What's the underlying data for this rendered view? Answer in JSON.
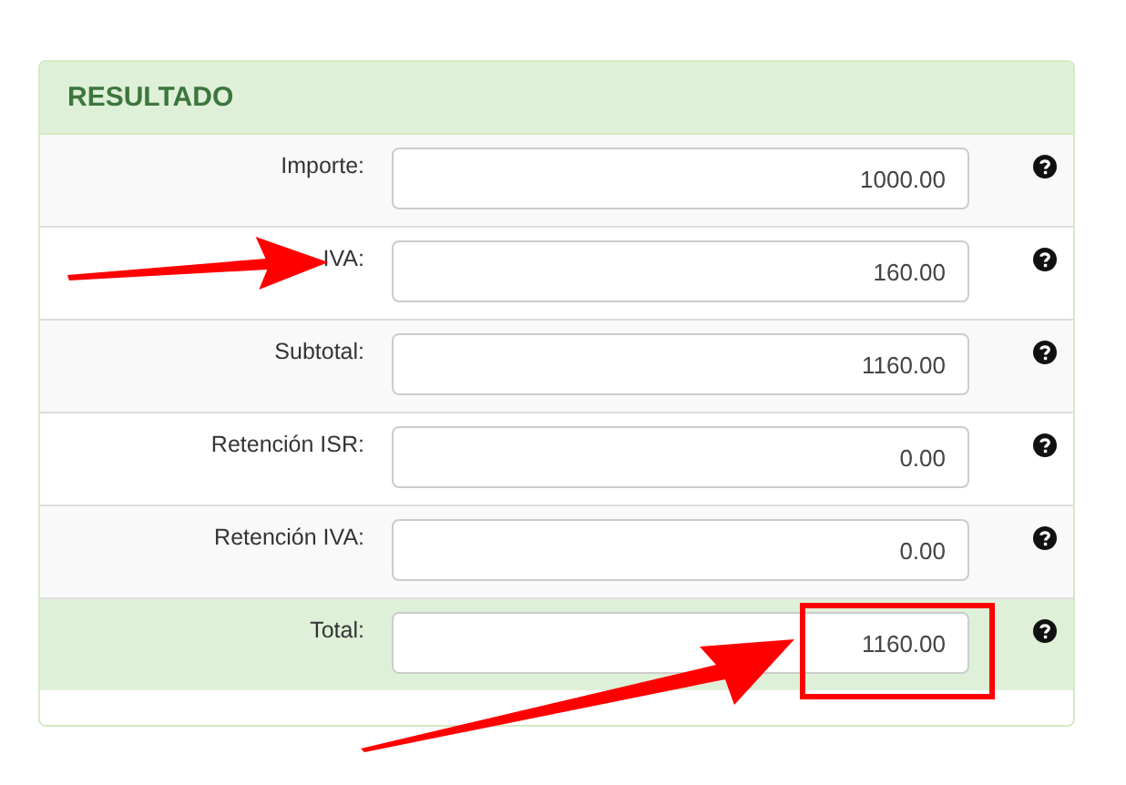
{
  "panel": {
    "title": "RESULTADO"
  },
  "rows": [
    {
      "label": "Importe:",
      "value": "1000.00",
      "highlighted": false,
      "pointed": false,
      "boxed": false
    },
    {
      "label": "IVA:",
      "value": "160.00",
      "highlighted": false,
      "pointed": true,
      "boxed": false
    },
    {
      "label": "Subtotal:",
      "value": "1160.00",
      "highlighted": false,
      "pointed": false,
      "boxed": false
    },
    {
      "label": "Retención ISR:",
      "value": "0.00",
      "highlighted": false,
      "pointed": false,
      "boxed": false
    },
    {
      "label": "Retención IVA:",
      "value": "0.00",
      "highlighted": false,
      "pointed": false,
      "boxed": false
    },
    {
      "label": "Total:",
      "value": "1160.00",
      "highlighted": true,
      "pointed": true,
      "boxed": true
    }
  ]
}
